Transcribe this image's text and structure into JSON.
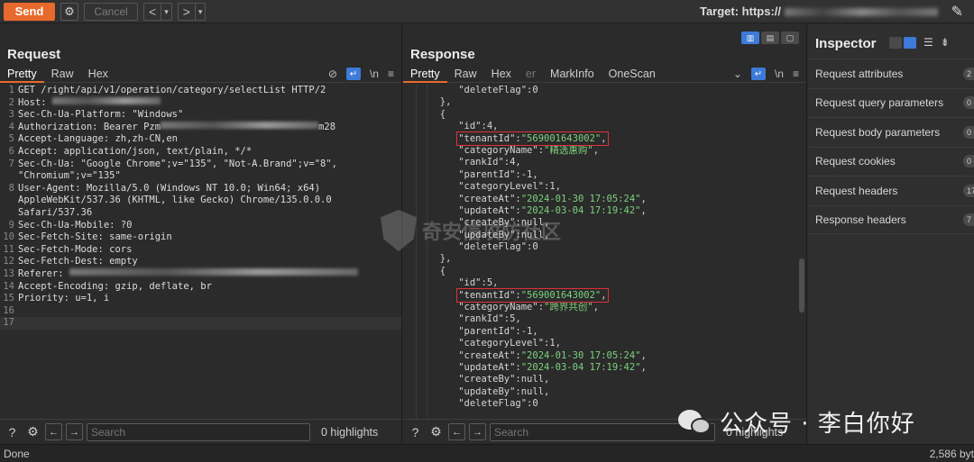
{
  "toolbar": {
    "send_label": "Send",
    "cancel_label": "Cancel",
    "target_label": "Target: https://"
  },
  "request": {
    "title": "Request",
    "tabs": [
      "Pretty",
      "Raw",
      "Hex"
    ],
    "newline_label": "\\n",
    "lines": [
      {
        "no": "1",
        "text": "GET /right/api/v1/operation/category/selectList HTTP/2"
      },
      {
        "no": "2",
        "text": "Host: "
      },
      {
        "no": "3",
        "text": "Sec-Ch-Ua-Platform: \"Windows\""
      },
      {
        "no": "4",
        "text": "Authorization: Bearer Pzm",
        "tail": "m28"
      },
      {
        "no": "5",
        "text": "Accept-Language: zh,zh-CN,en"
      },
      {
        "no": "6",
        "text": "Accept: application/json, text/plain, */*"
      },
      {
        "no": "7",
        "text": "Sec-Ch-Ua: \"Google Chrome\";v=\"135\", \"Not-A.Brand\";v=\"8\","
      },
      {
        "no": "",
        "text": "\"Chromium\";v=\"135\""
      },
      {
        "no": "8",
        "text": "User-Agent: Mozilla/5.0 (Windows NT 10.0; Win64; x64)"
      },
      {
        "no": "",
        "text": "AppleWebKit/537.36 (KHTML, like Gecko) Chrome/135.0.0.0"
      },
      {
        "no": "",
        "text": "Safari/537.36"
      },
      {
        "no": "9",
        "text": "Sec-Ch-Ua-Mobile: ?0"
      },
      {
        "no": "10",
        "text": "Sec-Fetch-Site: same-origin"
      },
      {
        "no": "11",
        "text": "Sec-Fetch-Mode: cors"
      },
      {
        "no": "12",
        "text": "Sec-Fetch-Dest: empty"
      },
      {
        "no": "13",
        "text": "Referer: "
      },
      {
        "no": "14",
        "text": "Accept-Encoding: gzip, deflate, br"
      },
      {
        "no": "15",
        "text": "Priority: u=1, i"
      },
      {
        "no": "16",
        "text": ""
      },
      {
        "no": "17",
        "text": ""
      }
    ],
    "search_placeholder": "Search",
    "highlights": "0 highlights"
  },
  "response": {
    "title": "Response",
    "tabs": [
      "Pretty",
      "Raw",
      "Hex",
      "er",
      "MarkInfo",
      "OneScan"
    ],
    "newline_label": "\\n",
    "json_lines": [
      {
        "indent": 6,
        "key": "\"deleteFlag\"",
        "sep": ":",
        "val": "0",
        "vtype": "n",
        "end": ""
      },
      {
        "indent": 4,
        "raw": "},"
      },
      {
        "indent": 4,
        "raw": "{"
      },
      {
        "indent": 6,
        "key": "\"id\"",
        "sep": ":",
        "val": "4",
        "vtype": "n",
        "end": ","
      },
      {
        "indent": 6,
        "key": "\"tenantId\"",
        "sep": ":",
        "val": "\"569001643002\"",
        "vtype": "s",
        "end": ",",
        "highlight": true
      },
      {
        "indent": 6,
        "key": "\"categoryName\"",
        "sep": ":",
        "val": "\"精选惠购\"",
        "vtype": "s",
        "end": ","
      },
      {
        "indent": 6,
        "key": "\"rankId\"",
        "sep": ":",
        "val": "4",
        "vtype": "n",
        "end": ","
      },
      {
        "indent": 6,
        "key": "\"parentId\"",
        "sep": ":",
        "val": "-1",
        "vtype": "n",
        "end": ","
      },
      {
        "indent": 6,
        "key": "\"categoryLevel\"",
        "sep": ":",
        "val": "1",
        "vtype": "n",
        "end": ","
      },
      {
        "indent": 6,
        "key": "\"createAt\"",
        "sep": ":",
        "val": "\"2024-01-30 17:05:24\"",
        "vtype": "s",
        "end": ","
      },
      {
        "indent": 6,
        "key": "\"updateAt\"",
        "sep": ":",
        "val": "\"2024-03-04 17:19:42\"",
        "vtype": "s",
        "end": ","
      },
      {
        "indent": 6,
        "key": "\"createBy\"",
        "sep": ":",
        "val": "null",
        "vtype": "n",
        "end": ","
      },
      {
        "indent": 6,
        "key": "\"updateBy\"",
        "sep": ":",
        "val": "null",
        "vtype": "n",
        "end": ","
      },
      {
        "indent": 6,
        "key": "\"deleteFlag\"",
        "sep": ":",
        "val": "0",
        "vtype": "n",
        "end": ""
      },
      {
        "indent": 4,
        "raw": "},"
      },
      {
        "indent": 4,
        "raw": "{"
      },
      {
        "indent": 6,
        "key": "\"id\"",
        "sep": ":",
        "val": "5",
        "vtype": "n",
        "end": ","
      },
      {
        "indent": 6,
        "key": "\"tenantId\"",
        "sep": ":",
        "val": "\"569001643002\"",
        "vtype": "s",
        "end": ",",
        "highlight": true
      },
      {
        "indent": 6,
        "key": "\"categoryName\"",
        "sep": ":",
        "val": "\"跨界共创\"",
        "vtype": "s",
        "end": ","
      },
      {
        "indent": 6,
        "key": "\"rankId\"",
        "sep": ":",
        "val": "5",
        "vtype": "n",
        "end": ","
      },
      {
        "indent": 6,
        "key": "\"parentId\"",
        "sep": ":",
        "val": "-1",
        "vtype": "n",
        "end": ","
      },
      {
        "indent": 6,
        "key": "\"categoryLevel\"",
        "sep": ":",
        "val": "1",
        "vtype": "n",
        "end": ","
      },
      {
        "indent": 6,
        "key": "\"createAt\"",
        "sep": ":",
        "val": "\"2024-01-30 17:05:24\"",
        "vtype": "s",
        "end": ","
      },
      {
        "indent": 6,
        "key": "\"updateAt\"",
        "sep": ":",
        "val": "\"2024-03-04 17:19:42\"",
        "vtype": "s",
        "end": ","
      },
      {
        "indent": 6,
        "key": "\"createBy\"",
        "sep": ":",
        "val": "null",
        "vtype": "n",
        "end": ","
      },
      {
        "indent": 6,
        "key": "\"updateBy\"",
        "sep": ":",
        "val": "null",
        "vtype": "n",
        "end": ","
      },
      {
        "indent": 6,
        "key": "\"deleteFlag\"",
        "sep": ":",
        "val": "0",
        "vtype": "n",
        "end": ""
      }
    ],
    "search_placeholder": "Search",
    "highlights": "0 highlights"
  },
  "inspector": {
    "title": "Inspector",
    "items": [
      {
        "label": "Request attributes",
        "badge": "2"
      },
      {
        "label": "Request query parameters",
        "badge": "0"
      },
      {
        "label": "Request body parameters",
        "badge": "0"
      },
      {
        "label": "Request cookies",
        "badge": "0"
      },
      {
        "label": "Request headers",
        "badge": "17"
      },
      {
        "label": "Response headers",
        "badge": "7"
      }
    ]
  },
  "status": {
    "left": "Done",
    "right": "2,586 byt"
  },
  "watermarks": {
    "center": "奇安信攻防社区",
    "wechat": "公众号 · 李白你好"
  },
  "colors": {
    "accent": "#e8692c",
    "highlight_box": "#e0303a",
    "string": "#7dd17d",
    "toggle_on": "#3d7ad9"
  }
}
